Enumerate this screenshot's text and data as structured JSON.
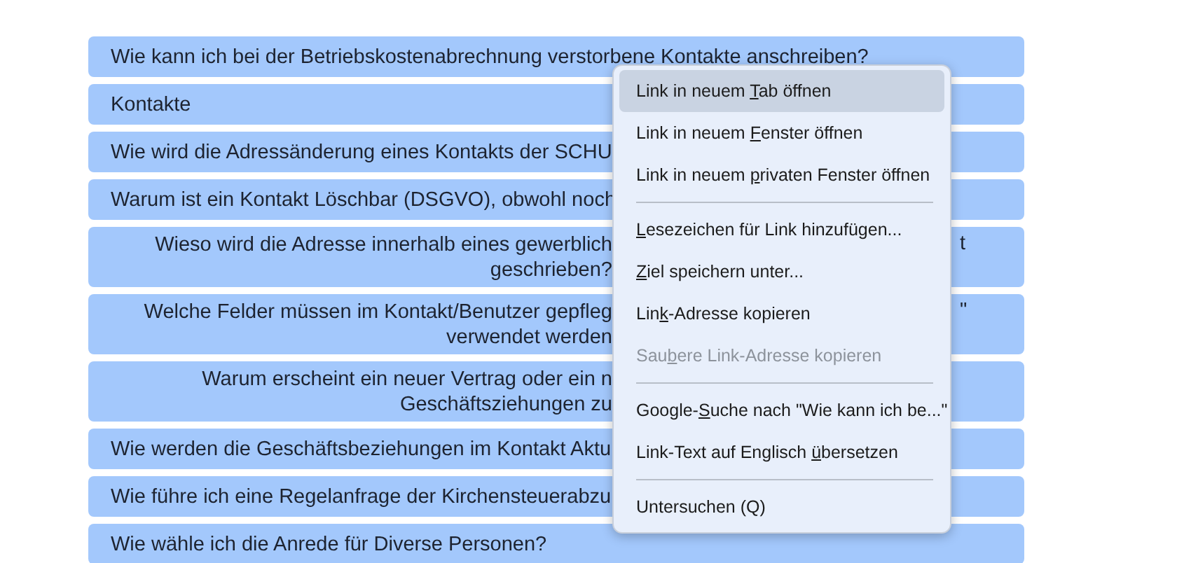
{
  "faq_rows": [
    {
      "lines": [
        "Wie kann ich bei der Betriebskostenabrechnung verstorbene Kontakte anschreiben?"
      ],
      "centered": false
    },
    {
      "lines": [
        "Kontakte"
      ],
      "centered": false
    },
    {
      "lines": [
        "Wie wird die Adressänderung eines Kontakts der SCHU"
      ],
      "centered": false
    },
    {
      "lines": [
        "Warum ist ein Kontakt Löschbar (DSGVO), obwohl noch"
      ],
      "centered": false
    },
    {
      "lines": [
        "Wieso wird die Adresse innerhalb eines gewerblich",
        "geschrieben?"
      ],
      "centered": true,
      "tail": "t"
    },
    {
      "lines": [
        "Welche Felder müssen im Kontakt/Benutzer gepfleg",
        "verwendet werden"
      ],
      "centered": true,
      "tail": "\""
    },
    {
      "lines": [
        "Warum erscheint ein neuer Vertrag oder ein n",
        "Geschäftsziehungen zu"
      ],
      "centered": true
    },
    {
      "lines": [
        "Wie werden die Geschäftsbeziehungen im Kontakt Aktu"
      ],
      "centered": false
    },
    {
      "lines": [
        "Wie führe ich eine Regelanfrage der Kirchensteuerabzu"
      ],
      "centered": false
    },
    {
      "lines": [
        "Wie wähle ich die Anrede für Diverse Personen?"
      ],
      "centered": false
    }
  ],
  "context_menu": [
    {
      "kind": "item",
      "before": "Link in neuem ",
      "key": "T",
      "after": "ab öffnen",
      "selected": true,
      "disabled": false
    },
    {
      "kind": "item",
      "before": "Link in neuem ",
      "key": "F",
      "after": "enster öffnen",
      "selected": false,
      "disabled": false
    },
    {
      "kind": "item",
      "before": "Link in neuem ",
      "key": "p",
      "after": "rivaten Fenster öffnen",
      "selected": false,
      "disabled": false
    },
    {
      "kind": "separator"
    },
    {
      "kind": "item",
      "key": "L",
      "after": "esezeichen für Link hinzufügen...",
      "selected": false,
      "disabled": false
    },
    {
      "kind": "item",
      "key": "Z",
      "after": "iel speichern unter...",
      "selected": false,
      "disabled": false
    },
    {
      "kind": "item",
      "before": "Lin",
      "key": "k",
      "after": "-Adresse kopieren",
      "selected": false,
      "disabled": false
    },
    {
      "kind": "item",
      "before": "Sau",
      "key": "b",
      "after": "ere Link-Adresse kopieren",
      "selected": false,
      "disabled": true
    },
    {
      "kind": "separator"
    },
    {
      "kind": "item",
      "before": "Google-",
      "key": "S",
      "after": "uche nach \"Wie kann ich be...\"",
      "selected": false,
      "disabled": false
    },
    {
      "kind": "item",
      "before": "Link-Text auf Englisch ",
      "key": "ü",
      "after": "bersetzen",
      "selected": false,
      "disabled": false
    },
    {
      "kind": "separator"
    },
    {
      "kind": "item",
      "before": "Untersuchen (Q)",
      "selected": false,
      "disabled": false
    }
  ]
}
